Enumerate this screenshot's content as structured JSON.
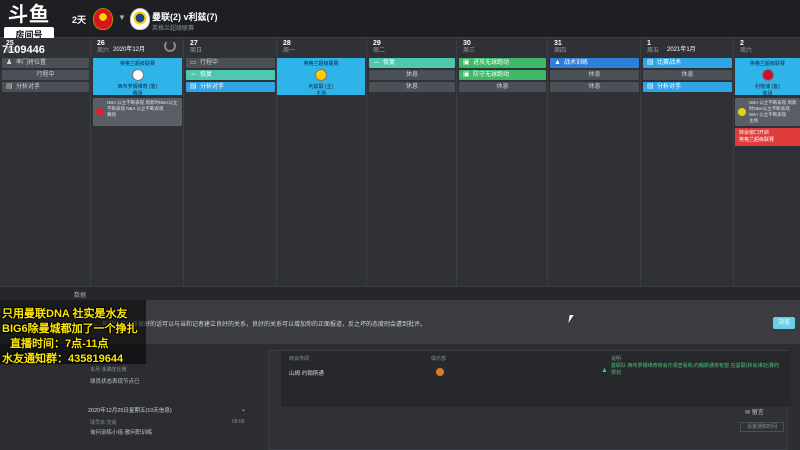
{
  "app": {
    "logo_text": "斗鱼",
    "logo_sub": "房间号",
    "room_id": "7109446"
  },
  "header": {
    "days_label": "2天",
    "match_title": "曼联(2) v利兹(7)",
    "match_sub": "英格兰超级联赛"
  },
  "calendar": {
    "columns": [
      {
        "day": "25",
        "week": "周五"
      },
      {
        "day": "26",
        "week": "周六",
        "month": "2020年12月"
      },
      {
        "day": "27",
        "week": "周日"
      },
      {
        "day": "28",
        "week": "周一"
      },
      {
        "day": "29",
        "week": "周二"
      },
      {
        "day": "30",
        "week": "周三"
      },
      {
        "day": "31",
        "week": "周四"
      },
      {
        "day": "1",
        "week": "周五",
        "month": "2021年1月"
      },
      {
        "day": "2",
        "week": "周六"
      }
    ],
    "col0": {
      "ev1": "率门将位置",
      "ev2": "行程中",
      "ev3": "分析对手"
    },
    "col1": {
      "card_title": "英格兰超级联赛",
      "card_sub1": "西布罗姆维奇 (客)",
      "card_sub2": "赛场",
      "news": "NBA 公立不断表现 周新时NBA公立不断表现 NBA 公立不断表现",
      "news_sub": "赛场"
    },
    "col2": {
      "ev1": "行程中",
      "ev2": "恢复",
      "ev3": "分析对手"
    },
    "col3": {
      "card_title": "英格兰超级联赛",
      "card_sub1": "利兹联 (主)",
      "card_sub2": "主场"
    },
    "col4": {
      "ev1": "恢复",
      "ev2": "休息",
      "ev3": "休息"
    },
    "col5": {
      "ev1": "进攻无球跑动",
      "ev2": "防守无球跑动",
      "ev3": "休息"
    },
    "col6": {
      "ev1": "战术训练",
      "ev2": "休息",
      "ev3": "休息"
    },
    "col7": {
      "ev1": "比赛战术",
      "ev2": "休息",
      "ev3": "分析对手"
    },
    "col8": {
      "card_title": "英格兰超级联赛",
      "card_sub1": "利物浦 (客)",
      "card_sub2": "客场",
      "news": "NBA 公立不断表现 周新时NBA公立不断表现 NBA 公立不断表现",
      "news_sub": "主场",
      "red1": "转会窗口开启",
      "red2": "英格兰超级联赛"
    }
  },
  "divider": {
    "label": "数据"
  },
  "message": {
    "text": "……与媒体的关系很好的话可以与当和记者建立良好的关系，良好的关系可以增加你的正面报道，反之坏的态度则会遭到批评。",
    "ok_label": "浏览"
  },
  "bottom": {
    "left": {
      "row1": "本月·未确定比赛",
      "row2": "球员状态表现节点已",
      "date_line": "2020年12月25日星期五(10天信息)",
      "row3": "球员本·交易",
      "row3b": "09:56",
      "row4": "询问训练小组·散问职训练"
    },
    "main": {
      "h1": "转会传闻",
      "h2": "俱乐部",
      "h3": "说明",
      "v1": "山姆·约翰斯通",
      "v3": "曼联队·西布罗姆维奇转会乐观查看和,约翰斯通将有望·在曼联(转会)和比赛的规划"
    },
    "right_ctl": "留言",
    "right_btn": "设置通知时间"
  },
  "overlay": {
    "line1": "只用曼联DNA 社实是水友",
    "line2": "BIG6除曼城都加了一个挣扎",
    "line3": "直播时间：7点-11点",
    "line4": "水友通知群：435819644"
  }
}
